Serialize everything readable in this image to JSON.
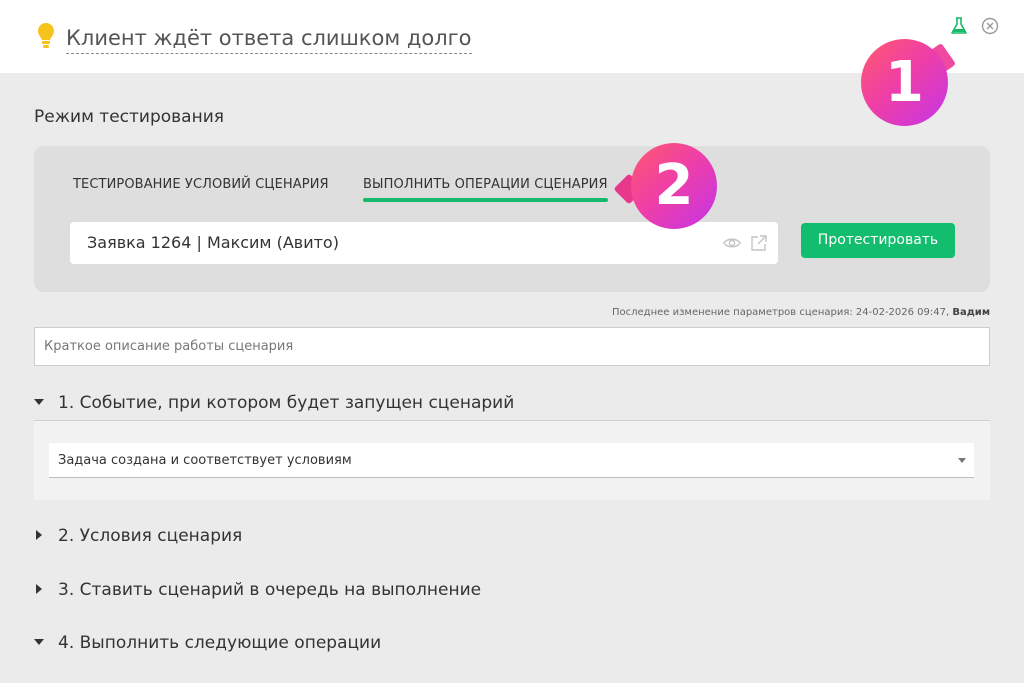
{
  "header": {
    "title": "Клиент ждёт ответа слишком долго",
    "icons": {
      "lightbulb": "lightbulb-icon",
      "flask": "flask-icon",
      "close": "close-circle-icon"
    }
  },
  "annotations": {
    "badge1": "1",
    "badge2": "2"
  },
  "testing": {
    "mode_label": "Режим тестирования",
    "tabs": [
      {
        "label": "ТЕСТИРОВАНИЕ УСЛОВИЙ СЦЕНАРИЯ",
        "active": false
      },
      {
        "label": "ВЫПОЛНИТЬ ОПЕРАЦИИ СЦЕНАРИЯ",
        "active": true
      }
    ],
    "deal_value": "Заявка 1264 | Максим (Авито)",
    "test_button": "Протестировать"
  },
  "last_change": {
    "text": "Последнее изменение параметров сценария: 24-02-2026 09:47, ",
    "user": "Вадим"
  },
  "description": {
    "placeholder": "Краткое описание работы сценария"
  },
  "sections": [
    {
      "label": "1. Событие, при котором будет запущен сценарий",
      "expanded": true
    },
    {
      "label": "2. Условия сценария",
      "expanded": false
    },
    {
      "label": "3. Ставить сценарий в очередь на выполнение",
      "expanded": false
    },
    {
      "label": "4. Выполнить следующие операции",
      "expanded": true
    }
  ],
  "event": {
    "selected": "Задача создана и соответствует условиям"
  },
  "colors": {
    "accent": "#13bd6e",
    "badge_gradient": [
      "#ff5a6e",
      "#c434e8"
    ],
    "bulb": "#f6c21c"
  }
}
